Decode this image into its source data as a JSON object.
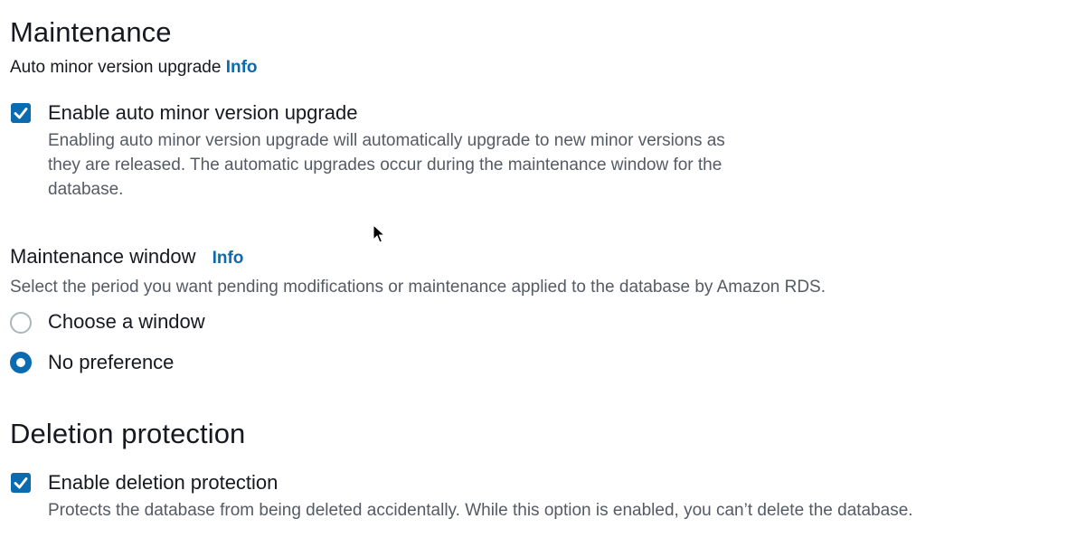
{
  "maintenance": {
    "heading": "Maintenance",
    "auto_minor": {
      "label": "Auto minor version upgrade",
      "info": "Info",
      "checkbox_label": "Enable auto minor version upgrade",
      "checked": true,
      "description_lines": [
        "Enabling auto minor version upgrade will automatically upgrade to new minor versions as",
        "they are released. The automatic upgrades occur during the maintenance window for the",
        "database."
      ]
    },
    "window": {
      "label": "Maintenance window",
      "info": "Info",
      "description": "Select the period you want pending modifications or maintenance applied to the database by Amazon RDS.",
      "options": [
        {
          "label": "Choose a window",
          "selected": false
        },
        {
          "label": "No preference",
          "selected": true
        }
      ]
    }
  },
  "deletion": {
    "heading": "Deletion protection",
    "checkbox_label": "Enable deletion protection",
    "checked": true,
    "description": "Protects the database from being deleted accidentally. While this option is enabled, you can’t delete the database."
  },
  "colors": {
    "accent": "#0a6bb0",
    "text": "#16191f",
    "muted": "#545b64"
  },
  "icons": {
    "checkbox": "check-icon",
    "cursor": "mouse-pointer-icon"
  }
}
